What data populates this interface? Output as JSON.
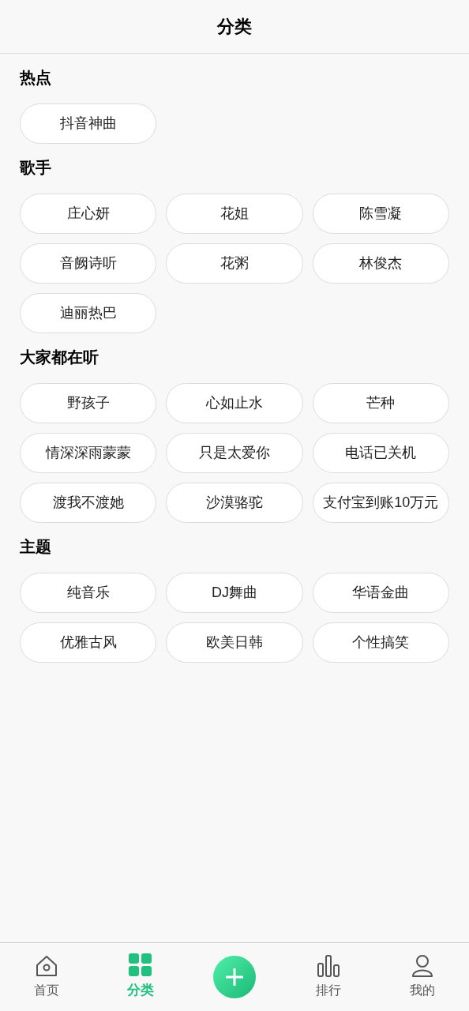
{
  "header": {
    "title": "分类"
  },
  "sections": [
    {
      "title": "热点",
      "tags": [
        "抖音神曲"
      ]
    },
    {
      "title": "歌手",
      "tags": [
        "庄心妍",
        "花姐",
        "陈雪凝",
        "音阙诗听",
        "花粥",
        "林俊杰",
        "迪丽热巴"
      ]
    },
    {
      "title": "大家都在听",
      "tags": [
        "野孩子",
        "心如止水",
        "芒种",
        "情深深雨蒙蒙",
        "只是太爱你",
        "电话已关机",
        "渡我不渡她",
        "沙漠骆驼",
        "支付宝到账10万元"
      ]
    },
    {
      "title": "主题",
      "tags": [
        "纯音乐",
        "DJ舞曲",
        "华语金曲",
        "优雅古风",
        "欧美日韩",
        "个性搞笑"
      ]
    }
  ],
  "nav": [
    {
      "kind": "home",
      "label": "首页",
      "selected": false
    },
    {
      "kind": "grid",
      "label": "分类",
      "selected": true
    },
    {
      "kind": "add"
    },
    {
      "kind": "chart",
      "label": "排行",
      "selected": false
    },
    {
      "kind": "person",
      "label": "我的",
      "selected": false
    }
  ]
}
